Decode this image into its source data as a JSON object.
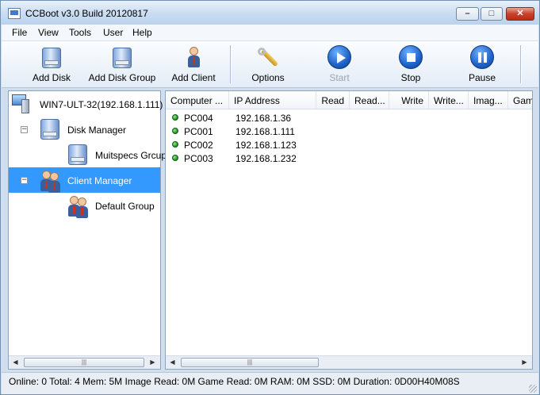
{
  "window": {
    "title": "CCBoot v3.0 Build 20120817",
    "controls": {
      "minimize": "–",
      "maximize": "□",
      "close": "✕"
    }
  },
  "menu": [
    "File",
    "View",
    "Tools",
    "User",
    "Help"
  ],
  "toolbar": {
    "add_disk": "Add Disk",
    "add_disk_group": "Add Disk Group",
    "add_client": "Add Client",
    "options": "Options",
    "start": "Start",
    "stop": "Stop",
    "pause": "Pause"
  },
  "tree": {
    "root": "WIN7-ULT-32(192.168.1.111)",
    "disk_manager": "Disk Manager",
    "disk_group": "Muitspecs Grcup",
    "client_manager": "Client Manager",
    "client_group": "Default Group",
    "collapse_symbol": "−"
  },
  "list": {
    "columns": [
      "Computer ...",
      "IP Address",
      "Read",
      "Read...",
      "Write",
      "Write...",
      "Imag...",
      "Gam"
    ],
    "rows": [
      {
        "name": "PC004",
        "ip": "192.168.1.36"
      },
      {
        "name": "PC001",
        "ip": "192.168.1.111"
      },
      {
        "name": "PC002",
        "ip": "192.168.1.123"
      },
      {
        "name": "PC003",
        "ip": "192.168.1.232"
      }
    ],
    "status_color": "#1b8a1b"
  },
  "scroll": {
    "left_arrow": "◀",
    "right_arrow": "▶",
    "thumb_grip": "|||"
  },
  "statusbar": {
    "text": "Online: 0 Total: 4 Mem: 5M Image Read: 0M Game Read: 0M RAM: 0M SSD: 0M Duration: 0D00H40M08S"
  },
  "colors": {
    "selection": "#3399ff",
    "frame": "#cfdff0"
  }
}
